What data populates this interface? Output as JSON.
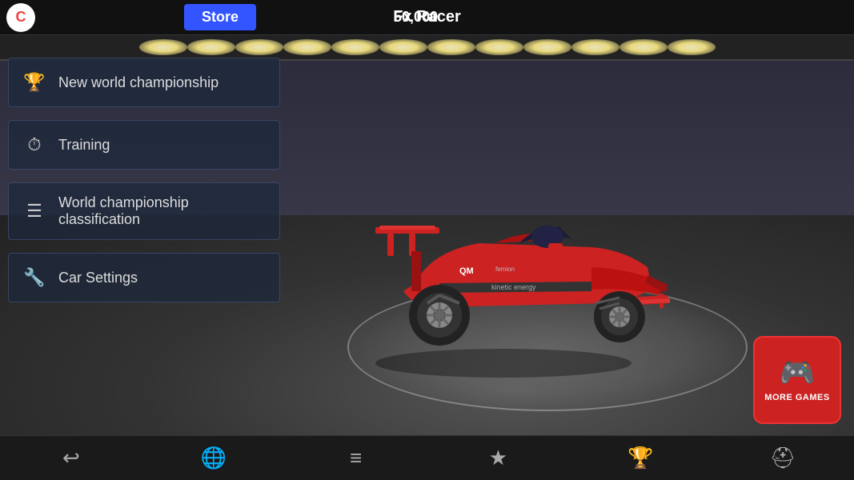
{
  "header": {
    "logo_text": "C",
    "coins": "50,000",
    "store_label": "Store",
    "title": "Fx Racer"
  },
  "menu": {
    "items": [
      {
        "id": "new-championship",
        "label": "New world championship",
        "icon": "trophy"
      },
      {
        "id": "training",
        "label": "Training",
        "icon": "stopwatch"
      },
      {
        "id": "classification",
        "label": "World championship classification",
        "icon": "list"
      },
      {
        "id": "car-settings",
        "label": "Car Settings",
        "icon": "wrench"
      }
    ]
  },
  "bottom_bar": {
    "buttons": [
      {
        "id": "back",
        "icon": "↩",
        "label": "back"
      },
      {
        "id": "globe",
        "icon": "🌐",
        "label": "globe"
      },
      {
        "id": "menu-list",
        "icon": "≡",
        "label": "menu"
      },
      {
        "id": "star",
        "icon": "★",
        "label": "star"
      },
      {
        "id": "trophy",
        "icon": "🏆",
        "label": "trophy"
      },
      {
        "id": "helmet",
        "icon": "⛑",
        "label": "helmet"
      }
    ]
  },
  "more_games": {
    "label": "MORE GAMES"
  }
}
